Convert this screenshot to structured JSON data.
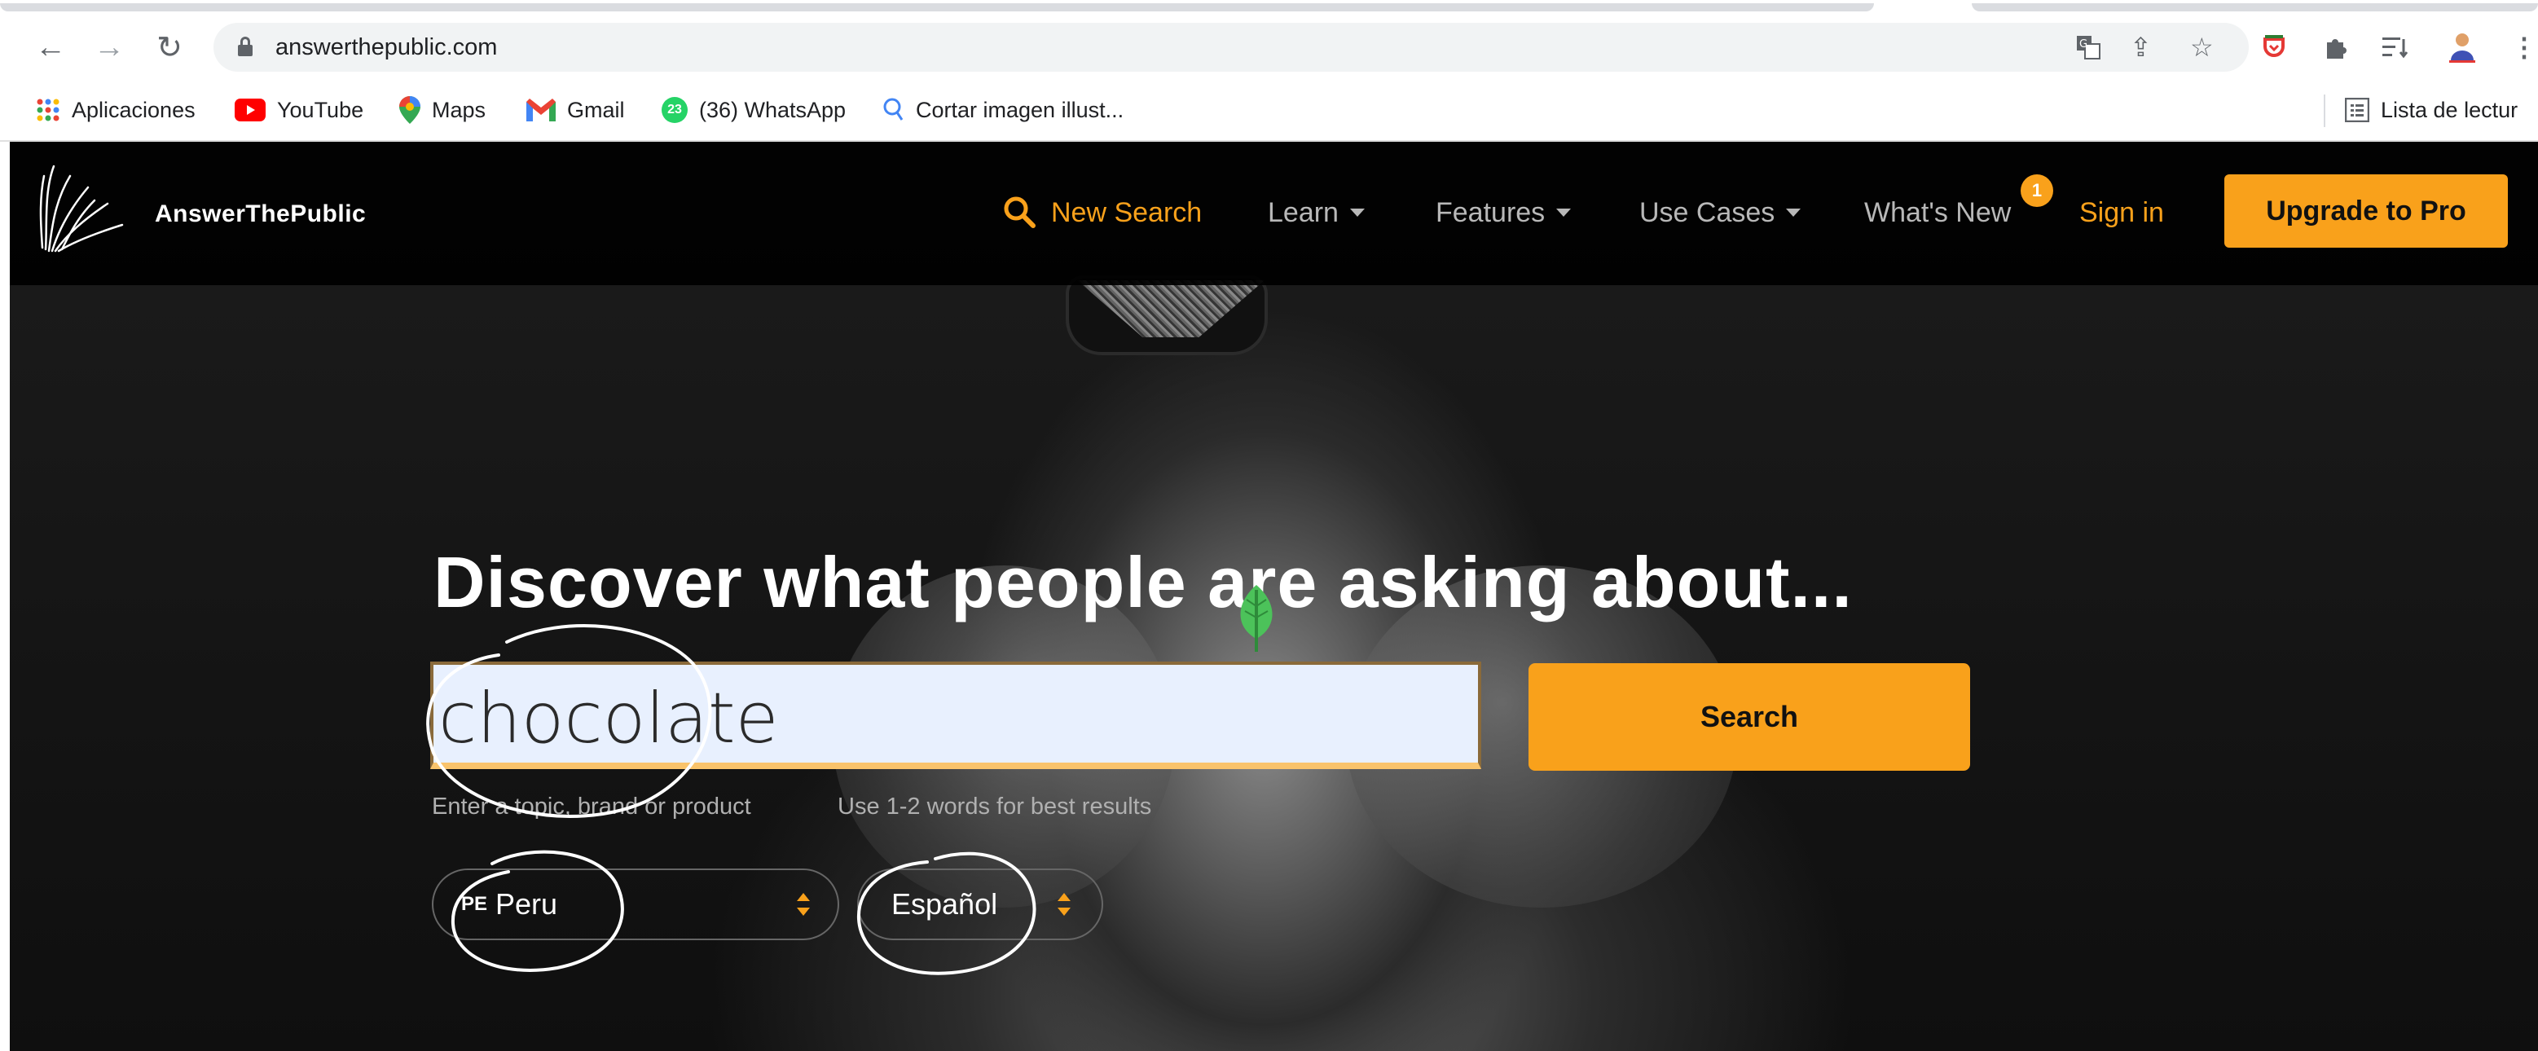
{
  "browser": {
    "url": "answerthepublic.com",
    "bookmarks": [
      {
        "label": "Aplicaciones",
        "icon": "apps-grid-icon"
      },
      {
        "label": "YouTube",
        "icon": "youtube-icon"
      },
      {
        "label": "Maps",
        "icon": "maps-pin-icon"
      },
      {
        "label": "Gmail",
        "icon": "gmail-icon"
      },
      {
        "label": "(36) WhatsApp",
        "icon": "whatsapp-icon",
        "badge": "23"
      },
      {
        "label": "Cortar imagen illust...",
        "icon": "search-bookmark-icon"
      }
    ],
    "reading_list": "Lista de lectur"
  },
  "site": {
    "logo_text": "AnswerThePublic",
    "nav": {
      "new_search": "New Search",
      "learn": "Learn",
      "features": "Features",
      "use_cases": "Use Cases",
      "whats_new": "What's New",
      "whats_new_badge": "1",
      "sign_in": "Sign in",
      "upgrade": "Upgrade to Pro"
    },
    "hero": {
      "title": "Discover what people are asking about...",
      "search_value": "chocolate",
      "search_button": "Search",
      "hint_left": "Enter a topic, brand or product",
      "hint_right": "Use 1-2 words for best results",
      "country_code": "PE",
      "country": "Peru",
      "language": "Español"
    }
  },
  "colors": {
    "accent": "#f9a11b",
    "header_bg": "#000000",
    "input_bg": "#e8f0fe"
  }
}
